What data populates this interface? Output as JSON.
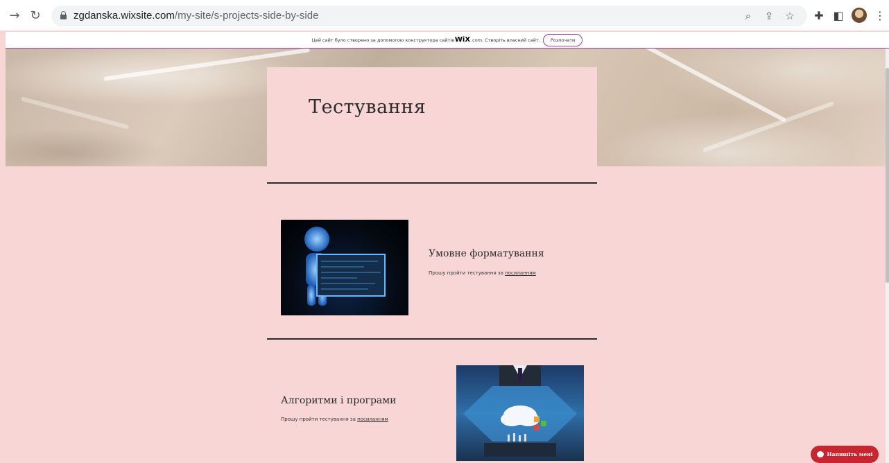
{
  "browser": {
    "url_host": "zgdanska.wixsite.com",
    "url_path": "/my-site/s-projects-side-by-side",
    "icons": [
      "forward-icon",
      "reload-icon",
      "lock-icon",
      "zoom-icon",
      "share-icon",
      "star-icon",
      "extensions-icon",
      "sidepanel-icon",
      "profile-avatar",
      "menu-icon"
    ]
  },
  "wix_banner": {
    "text_before": "Цей сайт було створено за допомогою конструктора сайтів",
    "logo": "WiX",
    "text_after": ".com. Створіть власний сайт.",
    "cta": "Розпочати"
  },
  "hero": {
    "title": "Тестування"
  },
  "projects": [
    {
      "title": "Умовне форматування",
      "text": "Прошу пройти тестування за ",
      "link": "посиланням"
    },
    {
      "title": "Алгоритми і програми",
      "text": "Прошу пройти тестування за ",
      "link": "посиланням"
    }
  ],
  "chat": {
    "label": "Напишіть мені"
  },
  "colors": {
    "page_bg": "#f9d6d6",
    "accent": "#9b3fa0",
    "chat": "#c7252f"
  }
}
